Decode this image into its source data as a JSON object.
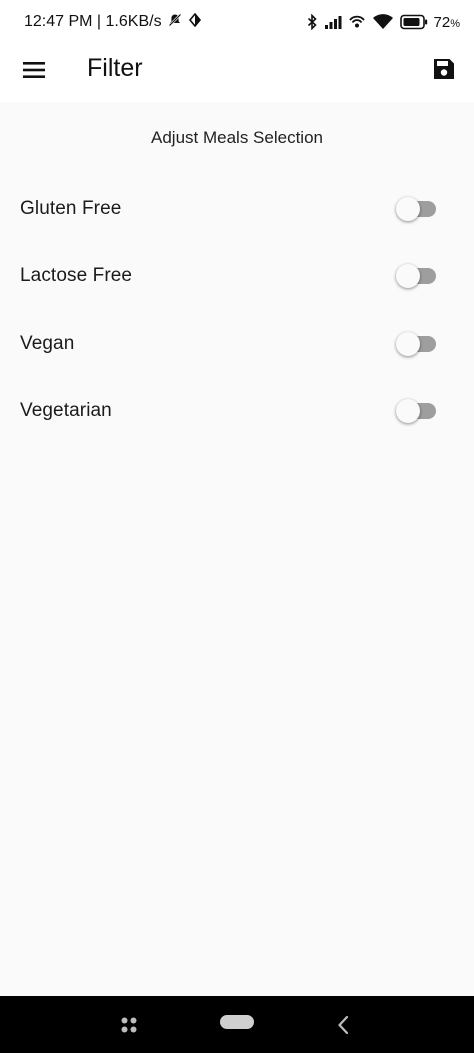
{
  "status_bar": {
    "time_speed": "12:47 PM | 1.6KB/s",
    "battery": "72",
    "battery_unit": "%"
  },
  "app_bar": {
    "title": "Filter",
    "menu_icon": "hamburger-menu-icon",
    "save_icon": "save-floppy-icon"
  },
  "filters": {
    "heading": "Adjust Meals Selection",
    "items": [
      {
        "label": "Gluten Free",
        "enabled": false
      },
      {
        "label": "Lactose Free",
        "enabled": false
      },
      {
        "label": "Vegan",
        "enabled": false
      },
      {
        "label": "Vegetarian",
        "enabled": false
      }
    ]
  },
  "colors": {
    "background": "#fafafa",
    "switch_track_off": "#9e9e9e",
    "nav_bar": "#000000"
  }
}
